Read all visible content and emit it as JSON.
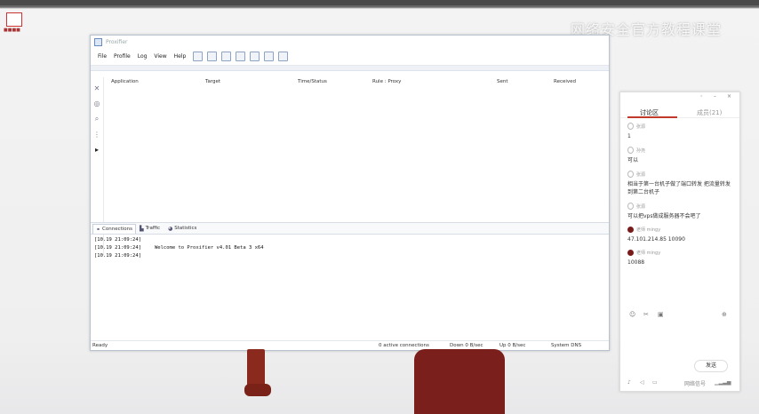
{
  "watermark": "网络安全官方教程课堂",
  "window": {
    "title": "Proxifier",
    "menu": [
      "File",
      "Profile",
      "Log",
      "View",
      "Help"
    ],
    "columns": [
      "Application",
      "Target",
      "Time/Status",
      "Rule : Proxy",
      "Sent",
      "Received"
    ],
    "tabs": [
      "Connections",
      "Traffic",
      "Statistics"
    ],
    "log": [
      {
        "time": "[10.19 21:09:24]",
        "text": ""
      },
      {
        "time": "[10.19 21:09:24]",
        "text": "Welcome to Proxifier v4.01 Beta 3 x64"
      },
      {
        "time": "[10.19 21:09:24]",
        "text": ""
      }
    ],
    "status": {
      "ready": "Ready",
      "connections": "0 active connections",
      "down": "Down 0 B/sec",
      "up": "Up 0 B/sec",
      "dns": "System DNS"
    }
  },
  "panel": {
    "tab_discussion": "讨论区",
    "tab_members": "成员(21)",
    "messages": [
      {
        "name": "张源",
        "text": "1"
      },
      {
        "name": "孙尧",
        "text": "可以"
      },
      {
        "name": "张源",
        "text": "相当于第一台机子做了端口转发 把流量转发到第二台机子"
      },
      {
        "name": "张源",
        "text": "可以把vps做成服务器不会吧了"
      },
      {
        "name": "老师 mingy",
        "text": "47.101.214.85 10090"
      },
      {
        "name": "老师 mingy",
        "text": "10088"
      }
    ],
    "send_label": "发送",
    "bottom_label": "网络信号"
  }
}
